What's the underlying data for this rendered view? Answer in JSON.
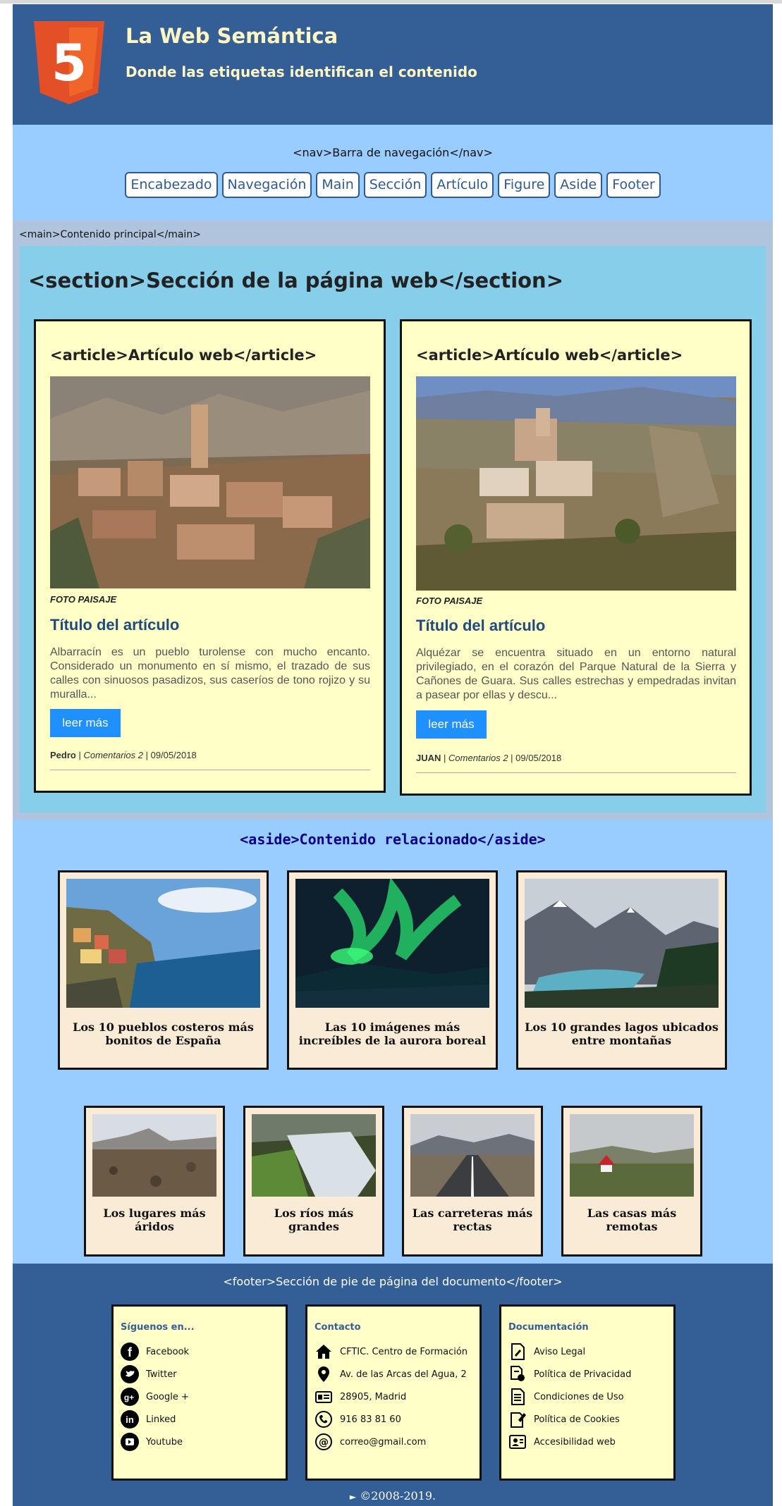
{
  "header": {
    "title": "La Web Semántica",
    "subtitle": "Donde las etiquetas identifican el contenido",
    "logo_digit": "5"
  },
  "nav": {
    "label": "<nav>Barra de navegación</nav>",
    "buttons": [
      "Encabezado",
      "Navegación",
      "Main",
      "Sección",
      "Artículo",
      "Figure",
      "Aside",
      "Footer"
    ]
  },
  "main": {
    "label": "<main>Contenido principal</main>",
    "section_title": "<section>Sección de la página web</section>",
    "articles": [
      {
        "tag_title": "<article>Artículo web</article>",
        "caption": "FOTO PAISAJE",
        "heading": "Título del artículo",
        "text": "Albarracín es un pueblo turolense con mucho encanto. Considerado un monumento en sí mismo, el trazado de sus calles con sinuosos pasadizos, sus caseríos de tono rojizo y su muralla...",
        "button": "leer más",
        "author": "Pedro",
        "sep1": " | ",
        "comments": "Comentarios 2",
        "sep2": " | ",
        "date": "09/05/2018"
      },
      {
        "tag_title": "<article>Artículo web</article>",
        "caption": "FOTO PAISAJE",
        "heading": "Título del artículo",
        "text": "Alquézar se encuentra situado en un entorno natural privilegiado, en el corazón del Parque Natural de la Sierra y Cañones de Guara. Sus calles estrechas y empedradas invitan a pasear por ellas y descu...",
        "button": "leer más",
        "author": "JUAN",
        "sep1": " | ",
        "comments": "Comentarios 2",
        "sep2": " | ",
        "date": "09/05/2018"
      }
    ]
  },
  "aside": {
    "title": "<aside>Contenido relacionado</aside>",
    "cards_large": [
      {
        "title": "Los 10 pueblos costeros más bonitos de España"
      },
      {
        "title": "Las 10 imágenes más increíbles de la aurora boreal"
      },
      {
        "title": "Los 10 grandes lagos ubicados entre montañas"
      }
    ],
    "cards_small": [
      {
        "title": "Los lugares más áridos"
      },
      {
        "title": "Los ríos más grandes"
      },
      {
        "title": "Las carreteras más rectas"
      },
      {
        "title": "Las casas más remotas"
      }
    ]
  },
  "footer": {
    "label": "<footer>Sección de pie de página del documento</footer>",
    "columns": [
      {
        "title": "Síguenos en...",
        "items": [
          {
            "icon": "facebook-icon",
            "label": "Facebook"
          },
          {
            "icon": "twitter-icon",
            "label": "Twitter"
          },
          {
            "icon": "google-plus-icon",
            "label": "Google +"
          },
          {
            "icon": "linkedin-icon",
            "label": "Linked"
          },
          {
            "icon": "youtube-icon",
            "label": "Youtube"
          }
        ]
      },
      {
        "title": "Contacto",
        "items": [
          {
            "icon": "home-icon",
            "label": "CFTIC. Centro de Formación"
          },
          {
            "icon": "location-pin-icon",
            "label": "Av. de las Arcas del Agua, 2"
          },
          {
            "icon": "id-card-icon",
            "label": "28905, Madrid"
          },
          {
            "icon": "phone-icon",
            "label": "916 83 81 60"
          },
          {
            "icon": "at-icon",
            "label": "correo@gmail.com"
          }
        ]
      },
      {
        "title": "Documentación",
        "items": [
          {
            "icon": "legal-notice-icon",
            "label": "Aviso Legal"
          },
          {
            "icon": "privacy-icon",
            "label": "Política de Privacidad"
          },
          {
            "icon": "document-icon",
            "label": "Condiciones de Uso"
          },
          {
            "icon": "cookies-doc-icon",
            "label": "Política de Cookies"
          },
          {
            "icon": "accessibility-icon",
            "label": "Accesibilidad web"
          }
        ]
      }
    ],
    "copyright": "©2008-2019.",
    "copyright_marker": "►"
  },
  "colors": {
    "header_bg": "#345e96",
    "nav_bg": "#99ccff",
    "main_bg": "#b0c4de",
    "section_bg": "#87ceeb",
    "article_bg": "#ffffc8",
    "card_bg": "#faebd7",
    "button_blue": "#1e90ff",
    "heading_blue": "#1f4a7f",
    "header_text": "#fff7c2"
  }
}
